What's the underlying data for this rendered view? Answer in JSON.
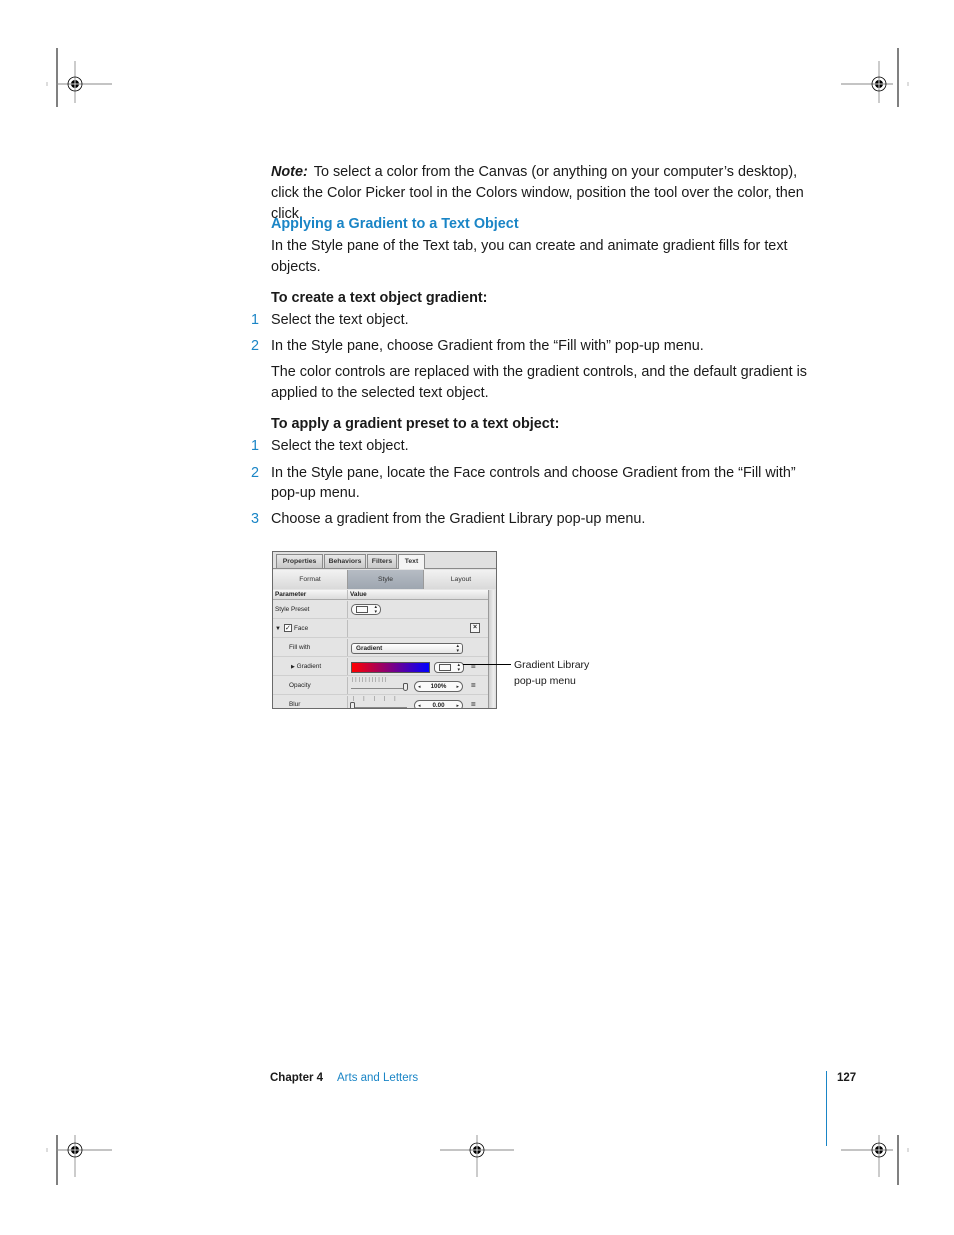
{
  "note": {
    "label": "Note:",
    "text": "To select a color from the Canvas (or anything on your computer’s desktop), click the Color Picker tool in the Colors window, position the tool over the color, then click."
  },
  "section": {
    "heading": "Applying a Gradient to a Text Object",
    "intro": "In the Style pane of the Text tab, you can create and animate gradient fills for text objects."
  },
  "task1": {
    "title": "To create a text object gradient:",
    "steps": [
      {
        "num": "1",
        "text": "Select the text object."
      },
      {
        "num": "2",
        "text": "In the Style pane, choose Gradient from the “Fill with” pop-up menu."
      }
    ],
    "result": "The color controls are replaced with the gradient controls, and the default gradient is applied to the selected text object."
  },
  "task2": {
    "title": "To apply a gradient preset to a text object:",
    "steps": [
      {
        "num": "1",
        "text": "Select the text object."
      },
      {
        "num": "2",
        "text": "In the Style pane, locate the Face controls and choose Gradient from the “Fill with” pop-up menu."
      },
      {
        "num": "3",
        "text": "Choose a gradient from the Gradient Library pop-up menu."
      }
    ]
  },
  "panel": {
    "tabs": [
      "Properties",
      "Behaviors",
      "Filters",
      "Text"
    ],
    "active_tab": "Text",
    "segments": [
      "Format",
      "Style",
      "Layout"
    ],
    "active_segment": "Style",
    "columns": [
      "Parameter",
      "Value"
    ],
    "rows": {
      "style_preset": "Style Preset",
      "face": "Face",
      "fill_with": "Fill with",
      "fill_with_value": "Gradient",
      "gradient": "Gradient",
      "opacity": "Opacity",
      "opacity_value": "100%",
      "blur": "Blur",
      "blur_value": "0.00"
    },
    "gradient_colors": [
      "#ff0000",
      "#0000ff"
    ],
    "opacity_fraction": 1.0,
    "blur_fraction": 0.0,
    "face_checked": true
  },
  "callout": {
    "line1": "Gradient Library",
    "line2": "pop-up menu"
  },
  "footer": {
    "chapter": "Chapter 4",
    "title": "Arts and Letters",
    "page": "127"
  },
  "colors": {
    "accent": "#1a85c6"
  }
}
